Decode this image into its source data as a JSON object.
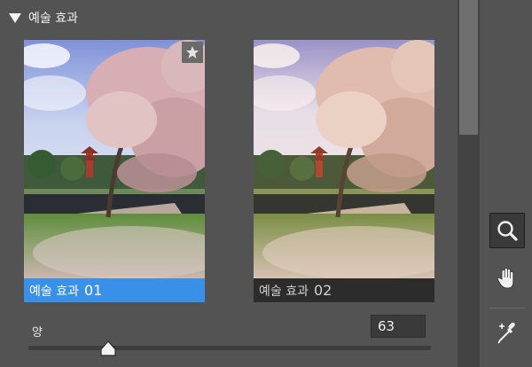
{
  "section": {
    "title": "예술 효과"
  },
  "effects": [
    {
      "name": "예술 효과",
      "number": "01",
      "selected": true,
      "favorite": true
    },
    {
      "name": "예술 효과",
      "number": "02",
      "selected": false,
      "favorite": false
    }
  ],
  "amount": {
    "label": "양",
    "value": "63",
    "level": 0.63
  },
  "tools": [
    "zoom-icon",
    "hand-icon",
    "eyedropper-icon"
  ],
  "colors": {
    "selected": "#3990e7",
    "panel": "#535353",
    "caption_dark": "#2c2c2c"
  }
}
